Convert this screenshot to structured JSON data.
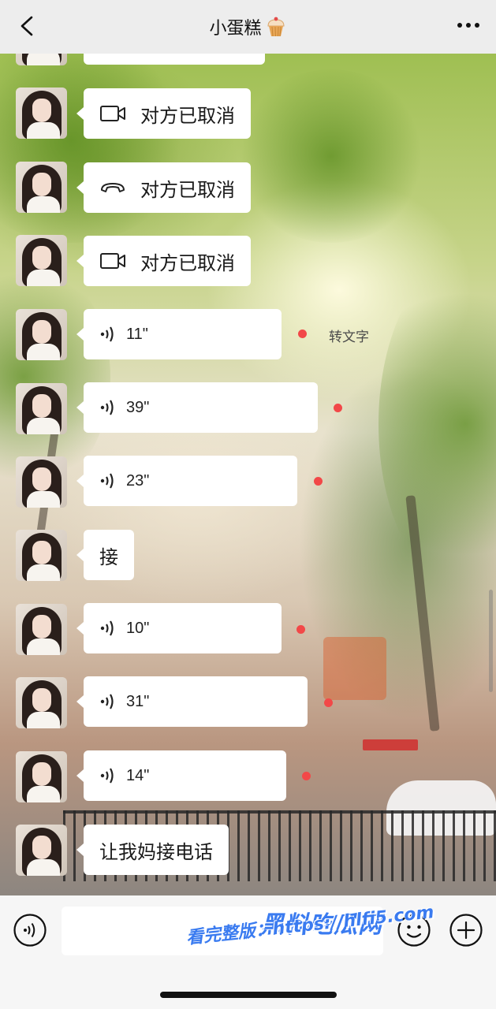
{
  "header": {
    "title": "小蛋糕",
    "back_icon": "chevron-left-icon",
    "title_emoji": "cupcake-icon",
    "more_icon": "ellipsis-icon"
  },
  "messages": [
    {
      "type": "video-call",
      "text": "对方已取消",
      "icon": "video-camera-icon"
    },
    {
      "type": "voice-call",
      "text": "对方已取消",
      "icon": "phone-hangup-icon"
    },
    {
      "type": "video-call",
      "text": "对方已取消",
      "icon": "video-camera-icon"
    },
    {
      "type": "voice",
      "duration": "11\"",
      "unread": true,
      "action": "转文字"
    },
    {
      "type": "voice",
      "duration": "39\"",
      "unread": true
    },
    {
      "type": "voice",
      "duration": "23\"",
      "unread": true
    },
    {
      "type": "text",
      "text": "接"
    },
    {
      "type": "voice",
      "duration": "10\"",
      "unread": true
    },
    {
      "type": "voice",
      "duration": "31\"",
      "unread": true
    },
    {
      "type": "voice",
      "duration": "14\"",
      "unread": true
    },
    {
      "type": "text",
      "text": "让我妈接电话"
    }
  ],
  "input_bar": {
    "voice_icon": "voice-mode-icon",
    "emoji_icon": "emoji-icon",
    "plus_icon": "plus-icon",
    "input_value": ""
  },
  "watermark": {
    "line1": "黑料吃瓜网",
    "line2": "看完整版：https://hlfi5.com"
  },
  "colors": {
    "unread_dot": "#f24848",
    "bubble": "#ffffff",
    "header_bg": "#ededed",
    "watermark": "#3a7bf0"
  }
}
